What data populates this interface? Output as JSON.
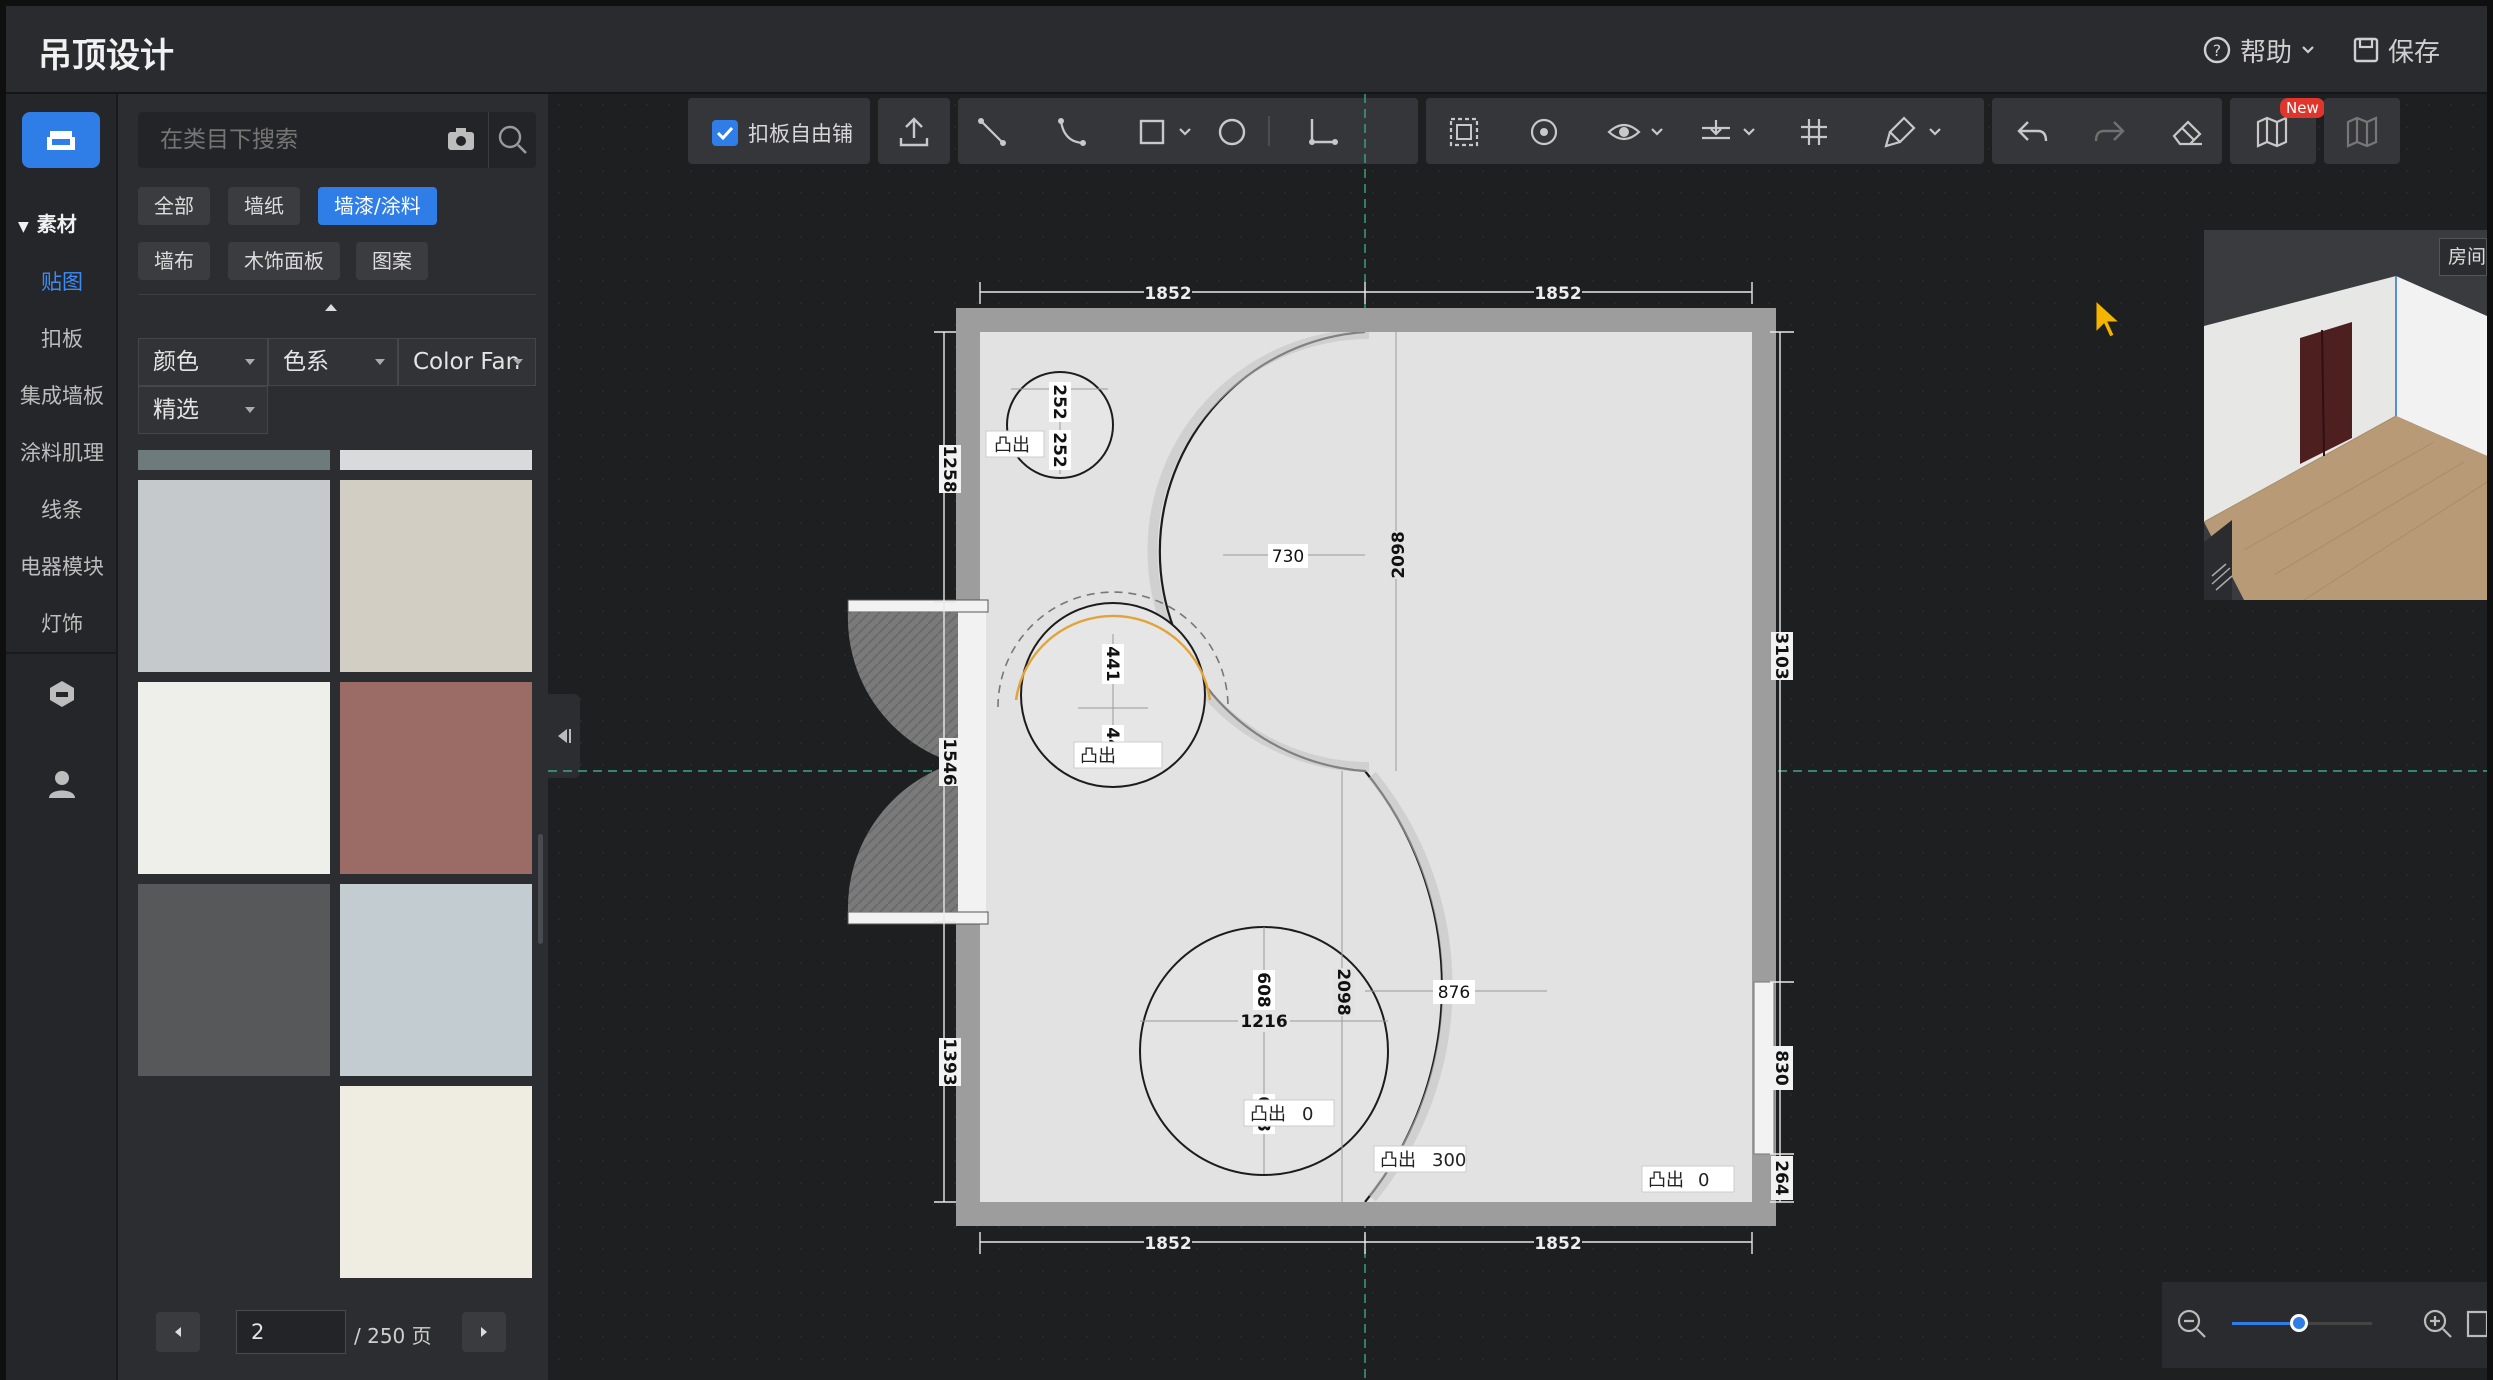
{
  "header": {
    "title": "吊顶设计",
    "help_label": "帮助",
    "save_label": "保存"
  },
  "rail": {
    "section_label": "素材",
    "items": [
      {
        "label": "贴图",
        "active": true
      },
      {
        "label": "扣板",
        "active": false
      },
      {
        "label": "集成墙板",
        "active": false
      },
      {
        "label": "涂料肌理",
        "active": false
      },
      {
        "label": "线条",
        "active": false
      },
      {
        "label": "电器模块",
        "active": false
      },
      {
        "label": "灯饰",
        "active": false
      }
    ]
  },
  "panel": {
    "search_placeholder": "在类目下搜索",
    "tags": [
      {
        "label": "全部",
        "active": false
      },
      {
        "label": "墙纸",
        "active": false
      },
      {
        "label": "墙漆/涂料",
        "active": true
      },
      {
        "label": "墙布",
        "active": false
      },
      {
        "label": "木饰面板",
        "active": false
      },
      {
        "label": "图案",
        "active": false
      }
    ],
    "filters": {
      "color": "颜色",
      "color_family": "色系",
      "color_fan": "Color Fan",
      "featured": "精选"
    },
    "swatches": [
      "#6d7b7d",
      "#d8dadb",
      "#c6c9cc",
      "#d3cec4",
      "#eeeeea",
      "#9b6c65",
      "#575859",
      "#c3ccd1",
      "#2c2d30",
      "#efece2"
    ],
    "pager": {
      "current_page": "2",
      "total_label": "/ 250 页"
    }
  },
  "toolbar": {
    "free_pave_label": "扣板自由铺",
    "new_badge": "New"
  },
  "plan": {
    "dims_top": [
      "1852",
      "1852"
    ],
    "dims_bottom": [
      "1852",
      "1852"
    ],
    "dims_left": [
      "1258",
      "1546",
      "1393"
    ],
    "dims_right": [
      "3103",
      "830",
      "264"
    ],
    "small_circle": [
      "252",
      "252"
    ],
    "arc_circle": [
      "441",
      "441"
    ],
    "bottom_circle": [
      "608",
      "1216",
      "608"
    ],
    "s_curve": [
      "730",
      "2098",
      "2098",
      "876"
    ],
    "convex_label": "凸出",
    "convex_values": [
      "0",
      "300",
      "0"
    ]
  },
  "preview": {
    "room_label": "房间"
  }
}
